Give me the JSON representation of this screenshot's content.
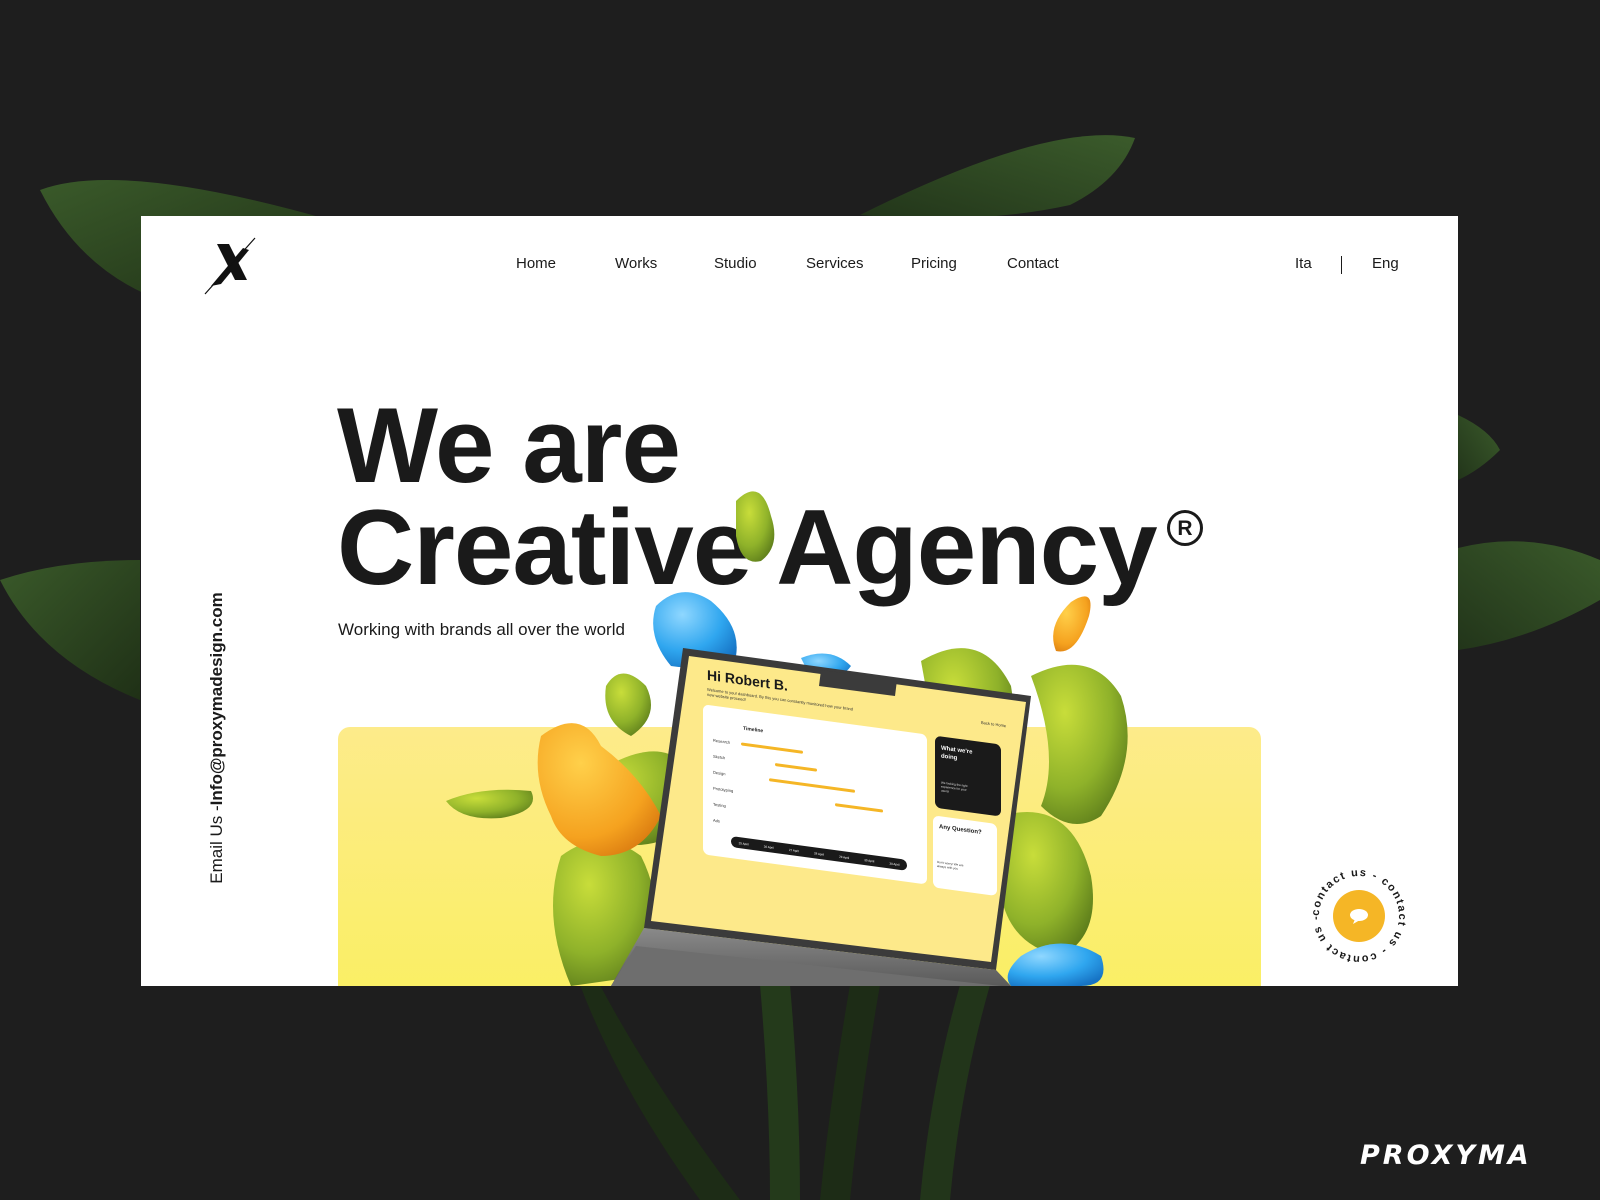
{
  "nav": {
    "items": [
      {
        "label": "Home"
      },
      {
        "label": "Works"
      },
      {
        "label": "Studio"
      },
      {
        "label": "Services"
      },
      {
        "label": "Pricing"
      },
      {
        "label": "Contact"
      }
    ]
  },
  "language": {
    "ita": "Ita",
    "eng": "Eng"
  },
  "sidebar": {
    "email_prefix": "Email Us -",
    "email": "Info@proxymadesign.com"
  },
  "hero": {
    "line1": "We are",
    "line2": "Creative Agency",
    "registered_mark": "R",
    "subtitle": "Working with brands all over the world"
  },
  "dashboard": {
    "greeting": "Hi Robert B.",
    "intro": "Welcome to your dashboard. By this you can constantly monitored how your brand new website proceed!",
    "back_link": "Back to Home",
    "timeline_title": "Timeline",
    "phases": [
      "Research",
      "Sketch",
      "Design",
      "Prototyping",
      "Testing",
      "Ads"
    ],
    "dates": [
      "25 April",
      "26 April",
      "27 April",
      "28 April",
      "29 April",
      "30 April",
      "30 April"
    ],
    "card_doing_title": "What we're doing",
    "card_doing_text": "We looking the right experience for your users!",
    "card_question_title": "Any Question?",
    "card_question_text": "Don't worry! We are always with you"
  },
  "contact_badge": {
    "text": "contact us - contact us - contact us - "
  },
  "brand": {
    "name": "PROXYMA"
  },
  "colors": {
    "background": "#1e1e1e",
    "accent_yellow": "#faef64",
    "accent_orange": "#f5b626",
    "text": "#1a1a1a",
    "leaf_green": "#2f4a22"
  }
}
